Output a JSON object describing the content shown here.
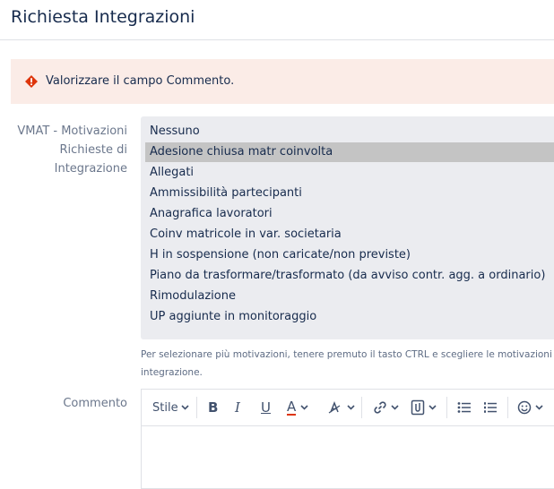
{
  "header": {
    "title": "Richiesta Integrazioni"
  },
  "alert": {
    "icon": "error-icon",
    "message": "Valorizzare il campo Commento."
  },
  "motivazioni": {
    "label_lines": [
      "VMAT - Motivazioni",
      "Richieste di",
      "Integrazione"
    ],
    "options": [
      "Nessuno",
      "Adesione chiusa matr coinvolta",
      "Allegati",
      "Ammissibilità partecipanti",
      "Anagrafica lavoratori",
      "Coinv matricole in var. societaria",
      "H in sospensione (non caricate/non previste)",
      "Piano da trasformare/trasformato (da avviso contr. agg. a ordinario)",
      "Rimodulazione",
      "UP aggiunte in monitoraggio"
    ],
    "selected": "Adesione chiusa matr coinvolta",
    "help_line1": "Per selezionare più motivazioni, tenere premuto il tasto CTRL e scegliere le motivazioni atti",
    "help_line2": "integrazione."
  },
  "commento": {
    "label": "Commento",
    "toolbar": {
      "style_label": "Stile",
      "bold": "B",
      "italic": "I",
      "underline": "U",
      "text_color": "A"
    }
  },
  "colors": {
    "alert_bg": "#fbece7",
    "error": "#de350b",
    "selected_bg": "#c4c4c4",
    "listbox_bg": "#ebecf0"
  }
}
